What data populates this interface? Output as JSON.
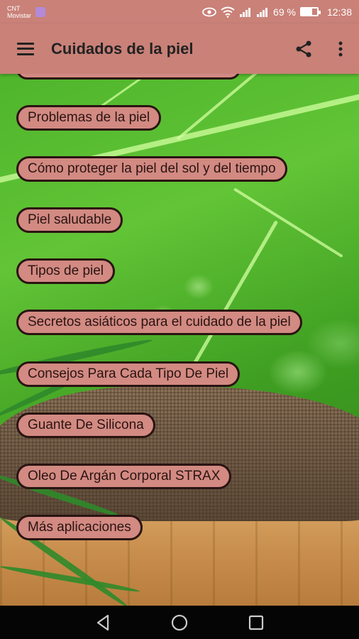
{
  "status_bar": {
    "carrier_line1": "CNT",
    "carrier_line2": "Movistar",
    "battery_text": "69 %",
    "battery_level": 0.69,
    "time": "12:38"
  },
  "app_bar": {
    "title": "Cuidados de la piel",
    "icons": [
      "hamburger-menu-icon",
      "share-icon",
      "more-vert-icon"
    ]
  },
  "menu": {
    "items": [
      {
        "label": "Problemas de la piel"
      },
      {
        "label": "Cómo proteger la piel del sol y del tiempo"
      },
      {
        "label": "Piel saludable"
      },
      {
        "label": "Tipos de piel"
      },
      {
        "label": "Secretos asiáticos para el cuidado de la piel"
      },
      {
        "label": "Consejos Para Cada Tipo De Piel"
      },
      {
        "label": "Guante De Silicona"
      },
      {
        "label": "Oleo De Argán Corporal STRAX"
      },
      {
        "label": "Más aplicaciones"
      }
    ]
  },
  "colors": {
    "accent": "#c98178",
    "pill_fill": "#d28a82",
    "pill_border": "#2a1412"
  }
}
